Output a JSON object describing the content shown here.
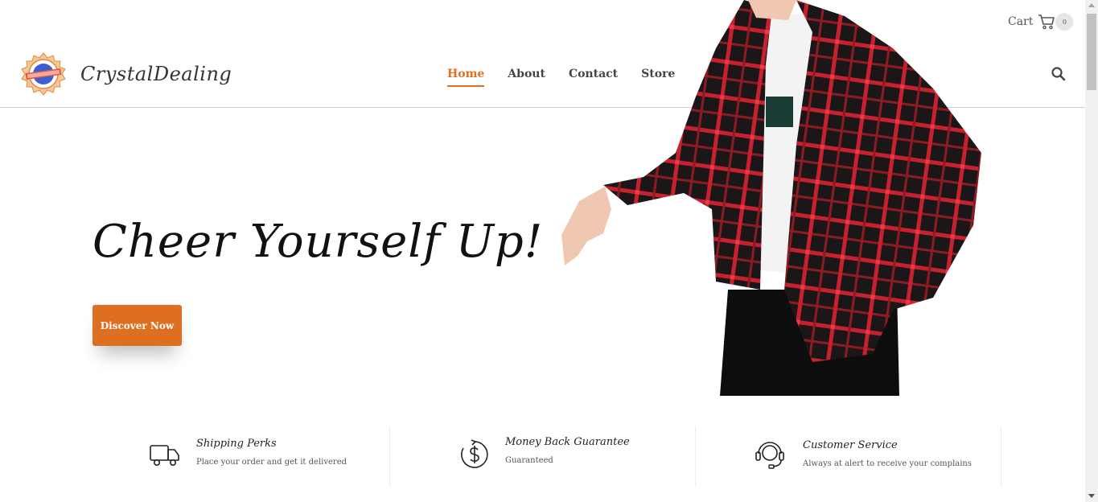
{
  "header": {
    "brand": "CrystalDealing",
    "nav": [
      {
        "label": "Home",
        "active": true
      },
      {
        "label": "About",
        "active": false
      },
      {
        "label": "Contact",
        "active": false
      },
      {
        "label": "Store",
        "active": false
      }
    ],
    "cart_label": "Cart",
    "cart_count": "0",
    "icons": {
      "cart": "cart-icon",
      "search": "search-icon"
    }
  },
  "hero": {
    "title": "Cheer Yourself Up!",
    "cta_label": "Discover Now",
    "image": "model-in-red-plaid-shirt"
  },
  "features": [
    {
      "icon": "truck-icon",
      "title": "Shipping Perks",
      "subtitle": "Place your order and get it delivered"
    },
    {
      "icon": "money-back-icon",
      "title": "Money Back Guarantee",
      "subtitle": "Guaranteed"
    },
    {
      "icon": "headset-icon",
      "title": "Customer Service",
      "subtitle": "Always at alert to receive your complains"
    }
  ],
  "colors": {
    "accent": "#df6f20",
    "text": "#333333"
  }
}
